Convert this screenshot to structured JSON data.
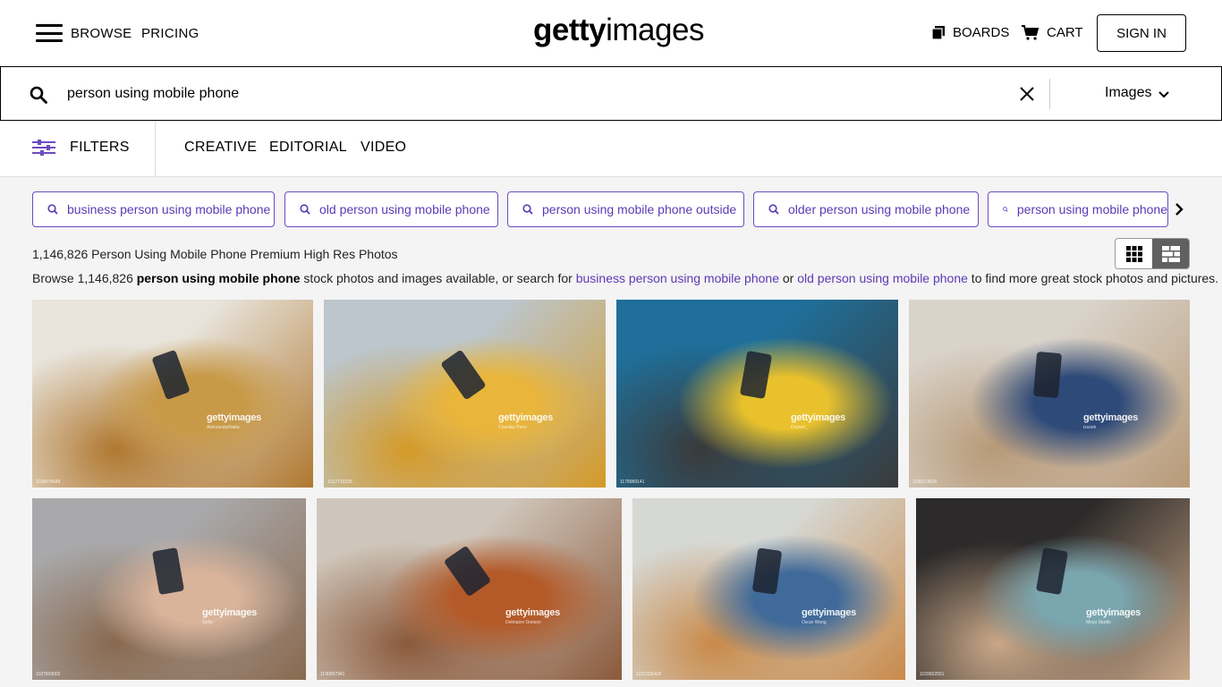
{
  "header": {
    "browse": "BROWSE",
    "pricing": "PRICING",
    "logo_bold": "getty",
    "logo_light": "images",
    "boards": "BOARDS",
    "cart": "CART",
    "sign_in": "SIGN IN"
  },
  "search": {
    "value": "person using mobile phone",
    "type": "Images"
  },
  "filterbar": {
    "filters": "FILTERS",
    "tabs": [
      "CREATIVE",
      "EDITORIAL",
      "VIDEO"
    ]
  },
  "related": [
    "business person using mobile phone",
    "old person using mobile phone",
    "person using mobile phone outside",
    "older person using mobile phone",
    "person using mobile phone"
  ],
  "results": {
    "count_text": "1,146,826 Person Using Mobile Phone Premium High Res Photos",
    "browse_prefix": "Browse 1,146,826 ",
    "browse_term": "person using mobile phone",
    "browse_mid": " stock photos and images available, or search for ",
    "browse_link1": "business person using mobile phone",
    "browse_or": " or ",
    "browse_link2": "old person using mobile phone",
    "browse_suffix": " to find more great stock photos and pictures."
  },
  "images": [
    {
      "watermark": "gettyimages",
      "credit": "AleksandarNakic",
      "id": "1168475549",
      "colors": [
        "#e8e4dc",
        "#c89a48",
        "#b07830"
      ]
    },
    {
      "watermark": "gettyimages",
      "credit": "Charday Penn",
      "id": "1312733325",
      "colors": [
        "#bcc6cc",
        "#e9b53a",
        "#d49a28"
      ]
    },
    {
      "watermark": "gettyimages",
      "credit": "Drazen_",
      "id": "1178989141",
      "colors": [
        "#1f6f9a",
        "#e8c12c",
        "#3a3a3a"
      ]
    },
    {
      "watermark": "gettyimages",
      "credit": "izusek",
      "id": "1189214920",
      "colors": [
        "#d9d3ca",
        "#2e4a78",
        "#b89a78"
      ]
    },
    {
      "watermark": "gettyimages",
      "credit": "Getty",
      "id": "1187509002",
      "colors": [
        "#a9a9ab",
        "#d9b39a",
        "#8a6a50"
      ]
    },
    {
      "watermark": "gettyimages",
      "credit": "Delmaine Donson",
      "id": "1190007941",
      "colors": [
        "#cfc6bb",
        "#b45a28",
        "#8b5a3c"
      ]
    },
    {
      "watermark": "gettyimages",
      "credit": "Oscar Wong",
      "id": "1221325418",
      "colors": [
        "#d6d8d4",
        "#3f6a9a",
        "#c98a4a"
      ]
    },
    {
      "watermark": "gettyimages",
      "credit": "Moyo Studio",
      "id": "1159502551",
      "colors": [
        "#2c2a2a",
        "#7aa6b0",
        "#c9a788"
      ]
    }
  ]
}
